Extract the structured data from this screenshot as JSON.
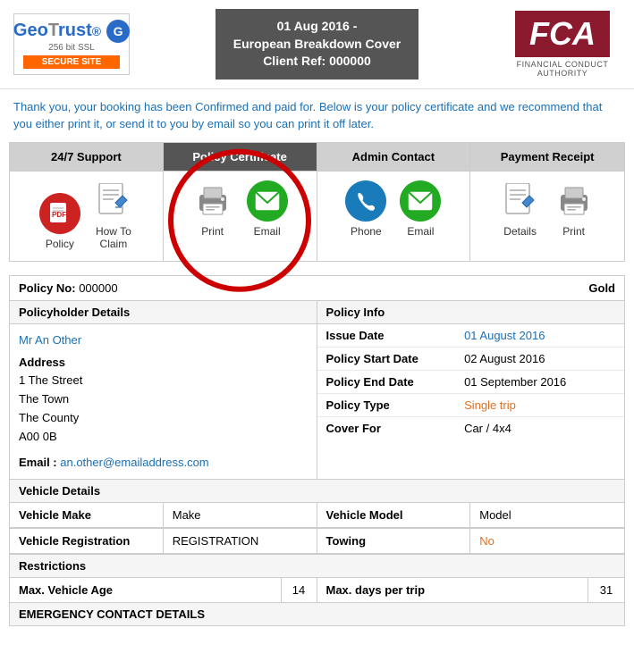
{
  "header": {
    "geotrust": {
      "brand": "GeoTrust",
      "ssl_text": "256 bit SSL",
      "secure_label": "SECURE SITE"
    },
    "middle": {
      "line1": "01 Aug 2016 -",
      "line2": "European Breakdown Cover",
      "line3": "Client Ref: 000000"
    },
    "fca": {
      "logo": "FCA",
      "subtitle": "FINANCIAL CONDUCT AUTHORITY"
    }
  },
  "confirm_text": "Thank you, your booking has been Confirmed and paid for. Below is your policy certificate and we recommend that you either print it, or send it to you by email so you can print it off later.",
  "tabs": {
    "tab1": {
      "header": "24/7 Support",
      "icons": [
        {
          "label": "Policy",
          "color": "red",
          "icon": "📄"
        },
        {
          "label": "How To\nClaim",
          "color": "none",
          "icon": "📝"
        }
      ]
    },
    "tab2": {
      "header": "Policy Certificate",
      "icons": [
        {
          "label": "Print",
          "color": "none",
          "icon": "🖨"
        },
        {
          "label": "Email",
          "color": "green",
          "icon": "✉"
        }
      ]
    },
    "tab3": {
      "header": "Admin Contact",
      "icons": [
        {
          "label": "Phone",
          "color": "blue",
          "icon": "📞"
        },
        {
          "label": "Email",
          "color": "green",
          "icon": "✉"
        }
      ]
    },
    "tab4": {
      "header": "Payment Receipt",
      "icons": [
        {
          "label": "Details",
          "color": "none",
          "icon": "📄"
        },
        {
          "label": "Print",
          "color": "none",
          "icon": "🖨"
        }
      ]
    }
  },
  "policy": {
    "no_label": "Policy No:",
    "no_value": "000000",
    "grade": "Gold",
    "policyholder_header": "Policyholder Details",
    "policy_info_header": "Policy Info",
    "name": "Mr An Other",
    "address_label": "Address",
    "address_lines": [
      "1 The Street",
      "The Town",
      "The County",
      "A00 0B"
    ],
    "email_label": "Email :",
    "email_value": "an.other@emailaddress.com",
    "issue_date_label": "Issue Date",
    "issue_date_value": "01 August 2016",
    "start_date_label": "Policy Start Date",
    "start_date_value": "02 August 2016",
    "end_date_label": "Policy End Date",
    "end_date_value": "01 September 2016",
    "type_label": "Policy Type",
    "type_value": "Single trip",
    "cover_label": "Cover For",
    "cover_value": "Car / 4x4",
    "vehicle_header": "Vehicle Details",
    "vehicle_make_label": "Vehicle Make",
    "vehicle_make_value": "Make",
    "vehicle_model_label": "Vehicle Model",
    "vehicle_model_value": "Model",
    "vehicle_reg_label": "Vehicle Registration",
    "vehicle_reg_value": "REGISTRATION",
    "towing_label": "Towing",
    "towing_value": "No",
    "restrictions_header": "Restrictions",
    "max_age_label": "Max. Vehicle Age",
    "max_age_value": "14",
    "max_days_label": "Max. days per trip",
    "max_days_value": "31",
    "emergency_header": "EMERGENCY CONTACT DETAILS"
  }
}
